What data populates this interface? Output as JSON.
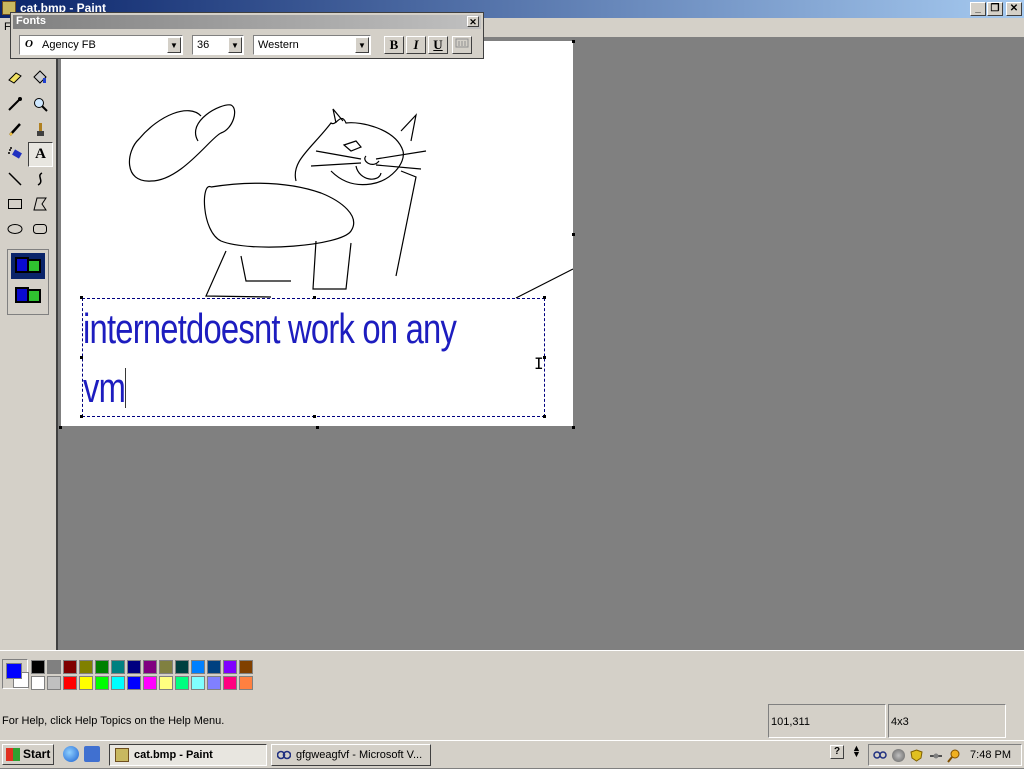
{
  "window": {
    "title": "cat.bmp - Paint"
  },
  "menubar": {
    "first_item": "F"
  },
  "fonts_toolbar": {
    "title": "Fonts",
    "font_name": "Agency FB",
    "font_size": "36",
    "script": "Western",
    "bold_label": "B",
    "italic_label": "I",
    "underline_label": "U"
  },
  "canvas": {
    "text_lines": [
      "internetdoesnt work on any",
      "vm"
    ]
  },
  "palette": {
    "foreground": "#0000ff",
    "background": "#ffffff",
    "row1": [
      "#000000",
      "#808080",
      "#800000",
      "#808000",
      "#008000",
      "#008080",
      "#000080",
      "#800080",
      "#808040",
      "#004040",
      "#0080ff",
      "#004080",
      "#8000ff",
      "#804000"
    ],
    "row2": [
      "#ffffff",
      "#c0c0c0",
      "#ff0000",
      "#ffff00",
      "#00ff00",
      "#00ffff",
      "#0000ff",
      "#ff00ff",
      "#ffff80",
      "#00ff80",
      "#80ffff",
      "#8080ff",
      "#ff0080",
      "#ff8040"
    ]
  },
  "statusbar": {
    "help_text": "For Help, click Help Topics on the Help Menu.",
    "coordinates": "101,311",
    "selection_size": "4x3"
  },
  "taskbar": {
    "start_label": "Start",
    "tasks": [
      {
        "label": "cat.bmp - Paint",
        "active": true
      },
      {
        "label": "gfgweagfvf - Microsoft V...",
        "active": false
      }
    ],
    "clock": "7:48 PM"
  }
}
